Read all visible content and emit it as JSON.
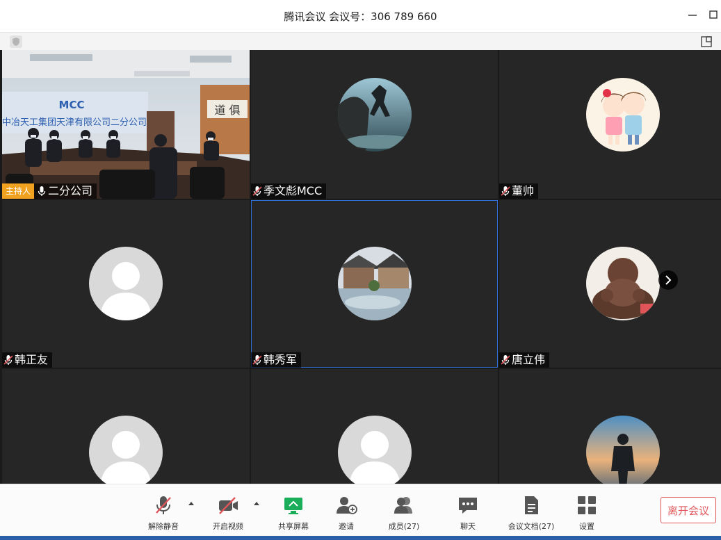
{
  "window": {
    "title": "腾讯会议 会议号：306 789 660"
  },
  "participants": [
    {
      "name": "二分公司",
      "host_label": "主持人",
      "muted": false
    },
    {
      "name": "季文彪MCC",
      "muted": true
    },
    {
      "name": "董帅",
      "muted": true
    },
    {
      "name": "韩正友",
      "muted": true
    },
    {
      "name": "韩秀军",
      "muted": true
    },
    {
      "name": "唐立伟",
      "muted": true
    },
    {
      "name": "",
      "muted": true
    },
    {
      "name": "",
      "muted": true
    },
    {
      "name": "",
      "muted": true
    }
  ],
  "video_scene": {
    "banner_text": "中冶天工集团天津有限公司二分公司",
    "logo_text": "MCC",
    "calligraphy": "道 俱"
  },
  "toolbar": {
    "unmute": "解除静音",
    "start_video": "开启视频",
    "share_screen": "共享屏幕",
    "invite": "邀请",
    "members": "成员(27)",
    "chat": "聊天",
    "docs": "会议文档(27)",
    "settings": "设置",
    "leave": "离开会议"
  },
  "colors": {
    "accent": "#2f6fd6",
    "host_badge": "#f1a120",
    "leave": "#e0555a",
    "share_green": "#1aad5a",
    "muted_red": "#e0555a"
  }
}
